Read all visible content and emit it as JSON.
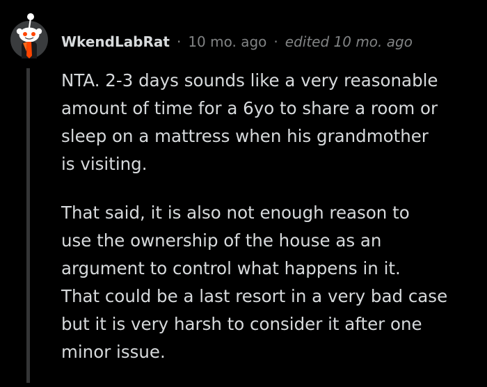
{
  "comment": {
    "author": "WkendLabRat",
    "separator": "·",
    "timestamp": "10 mo. ago",
    "edited": "edited 10 mo. ago",
    "avatar_icon": "snoo-avatar-icon",
    "paragraphs": [
      {
        "lines": [
          "NTA. 2-3 days sounds like a very reasonable",
          "amount of time for a 6yo to share a room or",
          "sleep on a mattress when his grandmother",
          "is visiting."
        ]
      },
      {
        "lines": [
          "That said, it is also not enough reason to",
          "use the ownership of the house as an",
          "argument to control what happens in it.",
          "That could be a last resort in a very bad case",
          "but it is very harsh to consider it after one",
          "minor issue."
        ]
      }
    ]
  },
  "colors": {
    "background": "#000000",
    "text": "#d7dadc",
    "meta": "#818384",
    "thread_line": "#343536",
    "avatar_bg": "#3a3c3e",
    "avatar_accent": "#ff4500"
  }
}
